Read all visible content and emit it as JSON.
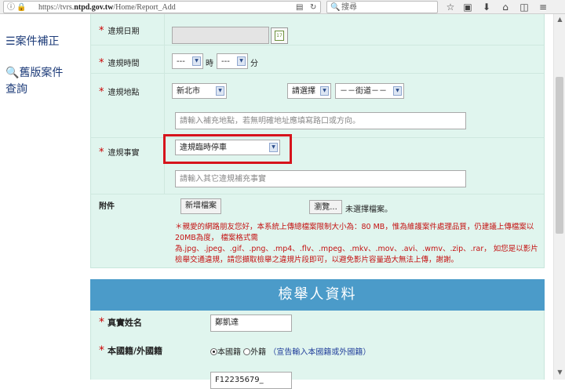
{
  "browser": {
    "url_prefix": "https://tvrs.",
    "url_domain": "ntpd.gov.tw",
    "url_path": "/Home/Report_Add",
    "search_placeholder": "搜尋"
  },
  "sidebar": {
    "items": [
      {
        "label": "案件補正",
        "icon": "list-icon"
      },
      {
        "label": "舊版案件",
        "label2": "查詢",
        "icon": "search-icon"
      }
    ]
  },
  "form": {
    "violation_date": {
      "label": "違規日期",
      "value": ""
    },
    "violation_time": {
      "label": "違規時間",
      "hour_value": "---",
      "hour_unit": "時",
      "minute_value": "---",
      "minute_unit": "分"
    },
    "violation_location": {
      "label": "違規地點",
      "city": "新北市",
      "district": "請選擇",
      "street": "－－街道－－",
      "supplement_placeholder": "請輸入補充地點，若無明確地址應填寫路口或方向。"
    },
    "violation_item": {
      "label": "違規事實",
      "value": "違規臨時停車",
      "supplement_placeholder": "請輸入其它違規補充事實"
    },
    "attachment": {
      "label": "附件",
      "add_button": "新增檔案",
      "browse_button": "瀏覽...",
      "status": "未選擇檔案。"
    },
    "notice": "＊親愛的網路朋友您好，本系統上傳總檔案限制大小為：80 MB，惟為維護案件處理品質，仍建議上傳檔案以20MB為度， 檔案格式需為.jpg、.jpeg、.gif、.png、.mp4、.flv、.mpeg、.mkv、.mov、.avi、.wmv、.zip、.rar， 如您是以影片檢舉交通違規，請您擷取檢舉之違規片段即可，以避免影片容量過大無法上傳，謝謝。"
  },
  "reporter": {
    "section_title": "檢舉人資料",
    "name": {
      "label": "真實姓名",
      "value": "鄭凱達"
    },
    "nationality": {
      "label": "本國籍/外國籍",
      "option_domestic": "本國籍",
      "option_foreign": "外籍",
      "selected": "本國籍",
      "note": "（宣告輸入本國籍或外國籍）"
    },
    "id_number_partial": "F12235679_"
  },
  "colors": {
    "panel_bg": "#e0f5ee",
    "section_header_bg": "#4b9bc9",
    "required_mark": "#cc0000",
    "highlight_border": "#d6141c",
    "sidebar_link": "#1f3d7a"
  }
}
